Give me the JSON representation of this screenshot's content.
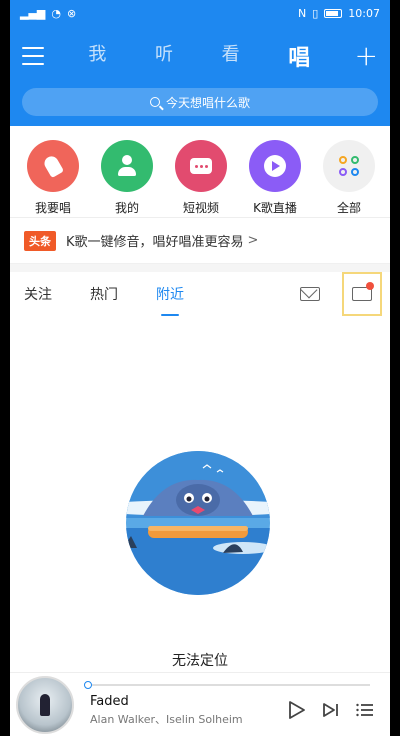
{
  "status_bar": {
    "time": "10:07"
  },
  "header": {
    "tabs": [
      "我",
      "听",
      "看",
      "唱"
    ],
    "active_tab": "唱",
    "search_placeholder": "今天想唱什么歌"
  },
  "quick_links": [
    {
      "label": "我要唱",
      "color": "#f0655a"
    },
    {
      "label": "我的",
      "color": "#33bb6f"
    },
    {
      "label": "短视频",
      "color": "#e24b6f"
    },
    {
      "label": "K歌直播",
      "color": "#8b5cf6"
    },
    {
      "label": "全部",
      "color": "#f0f0f0"
    }
  ],
  "headline": {
    "badge": "头条",
    "text": "K歌一键修音，唱好唱准更容易",
    "chevron": ">"
  },
  "feed_tabs": [
    "关注",
    "热门",
    "附近"
  ],
  "active_feed_tab": "附近",
  "empty_state": {
    "message": "无法定位"
  },
  "player": {
    "title": "Faded",
    "artist": "Alan Walker、Iselin Solheim",
    "progress": 0
  },
  "colors": {
    "brand": "#1e88f0",
    "badge": "#f05a28",
    "highlight": "#f5d77a"
  }
}
